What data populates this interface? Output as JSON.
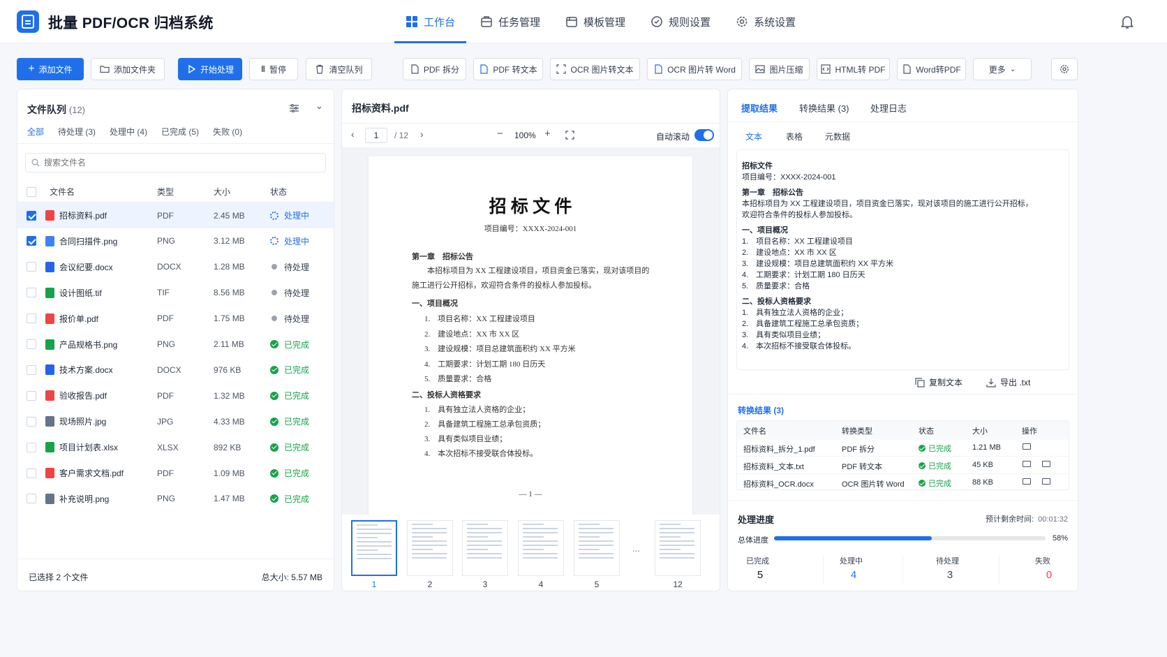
{
  "app": {
    "title": "批量 PDF/OCR 归档系统"
  },
  "nav": [
    {
      "label": "工作台",
      "active": true
    },
    {
      "label": "任务管理"
    },
    {
      "label": "模板管理"
    },
    {
      "label": "规则设置"
    },
    {
      "label": "系统设置"
    }
  ],
  "toolbar": {
    "add_file": "添加文件",
    "add_folder": "添加文件夹",
    "start": "开始处理",
    "pause": "暂停",
    "clear": "清空队列",
    "tools": [
      "PDF 拆分",
      "PDF 转文本",
      "OCR 图片转文本",
      "OCR 图片转 Word",
      "图片压缩",
      "HTML转 PDF",
      "Word转PDF"
    ],
    "more": "更多"
  },
  "queue": {
    "title": "文件队列",
    "count": "(12)",
    "tabs": [
      "全部",
      "待处理 (3)",
      "处理中 (4)",
      "已完成 (5)",
      "失败 (0)"
    ],
    "search_placeholder": "搜索文件名",
    "headers": [
      "文件名",
      "类型",
      "大小",
      "状态"
    ],
    "rows": [
      {
        "name": "招标资料.pdf",
        "type": "PDF",
        "size": "2.45 MB",
        "status": "处理中",
        "state": "processing",
        "checked": true,
        "kind": "pdf"
      },
      {
        "name": "合同扫描件.png",
        "type": "PNG",
        "size": "3.12 MB",
        "status": "处理中",
        "state": "processing",
        "checked": true,
        "kind": "png"
      },
      {
        "name": "会议纪要.docx",
        "type": "DOCX",
        "size": "1.28 MB",
        "status": "待处理",
        "state": "pending",
        "checked": false,
        "kind": "docx"
      },
      {
        "name": "设计图纸.tif",
        "type": "TIF",
        "size": "8.56 MB",
        "status": "待处理",
        "state": "pending",
        "checked": false,
        "kind": "tif"
      },
      {
        "name": "报价单.pdf",
        "type": "PDF",
        "size": "1.75 MB",
        "status": "待处理",
        "state": "pending",
        "checked": false,
        "kind": "pdf"
      },
      {
        "name": "产品规格书.png",
        "type": "PNG",
        "size": "2.11 MB",
        "status": "已完成",
        "state": "done",
        "checked": false,
        "kind": "xls"
      },
      {
        "name": "技术方案.docx",
        "type": "DOCX",
        "size": "976 KB",
        "status": "已完成",
        "state": "done",
        "checked": false,
        "kind": "docx"
      },
      {
        "name": "验收报告.pdf",
        "type": "PDF",
        "size": "1.32 MB",
        "status": "已完成",
        "state": "done",
        "checked": false,
        "kind": "pdf"
      },
      {
        "name": "现场照片.jpg",
        "type": "JPG",
        "size": "4.33 MB",
        "status": "已完成",
        "state": "done",
        "checked": false,
        "kind": "img"
      },
      {
        "name": "项目计划表.xlsx",
        "type": "XLSX",
        "size": "892 KB",
        "status": "已完成",
        "state": "done",
        "checked": false,
        "kind": "xls"
      },
      {
        "name": "客户需求文档.pdf",
        "type": "PDF",
        "size": "1.09 MB",
        "status": "已完成",
        "state": "done",
        "checked": false,
        "kind": "pdf"
      },
      {
        "name": "补充说明.png",
        "type": "PNG",
        "size": "1.47 MB",
        "status": "已完成",
        "state": "done",
        "checked": false,
        "kind": "img"
      }
    ],
    "selected": "已选择 2 个文件",
    "total": "总大小: 5.57 MB"
  },
  "preview": {
    "filename": "招标资料.pdf",
    "page": "1",
    "pages": "/ 12",
    "zoom": "100%",
    "auto_scroll": "自动滚动",
    "doc": {
      "title": "招 标 文 件",
      "number": "项目编号：XXXX-2024-001",
      "ch1": "第一章　招标公告",
      "p1": "本招标项目为 XX 工程建设项目，项目资金已落实，现对该项目的",
      "p2": "施工进行公开招标，欢迎符合条件的投标人参加投标。",
      "s1": "一、项目概况",
      "items1": [
        "1.　项目名称：XX 工程建设项目",
        "2.　建设地点：XX 市 XX 区",
        "3.　建设规模：项目总建筑面积约 XX 平方米",
        "4.　工期要求：计划工期 180 日历天",
        "5.　质量要求：合格"
      ],
      "s2": "二、投标人资格要求",
      "items2": [
        "1.　具有独立法人资格的企业；",
        "2.　具备建筑工程施工总承包资质；",
        "3.　具有类似项目业绩；",
        "4.　本次招标不接受联合体投标。"
      ],
      "footer": "— 1 —"
    },
    "thumbs": [
      "1",
      "2",
      "3",
      "4",
      "5",
      "12"
    ],
    "ellipsis": "..."
  },
  "result": {
    "tabs": [
      "提取结果",
      "转换结果 (3)",
      "处理日志"
    ],
    "subtabs": [
      "文本",
      "表格",
      "元数据"
    ],
    "text_lines": [
      {
        "t": "招标文件",
        "b": true
      },
      {
        "t": "项目编号：XXXX-2024-001"
      },
      {
        "t": "第一章　招标公告",
        "b": true,
        "gap": true
      },
      {
        "t": "本招标项目为 XX 工程建设项目，项目资金已落实，现对该项目的施工进行公开招标，"
      },
      {
        "t": "欢迎符合条件的投标人参加投标。"
      },
      {
        "t": "一、项目概况",
        "b": true,
        "gap": true
      },
      {
        "t": "1.　项目名称：XX 工程建设项目"
      },
      {
        "t": "2.　建设地点：XX 市 XX 区"
      },
      {
        "t": "3.　建设规模：项目总建筑面积约 XX 平方米"
      },
      {
        "t": "4.　工期要求：计划工期 180 日历天"
      },
      {
        "t": "5.　质量要求：合格"
      },
      {
        "t": "二、投标人资格要求",
        "b": true,
        "gap": true
      },
      {
        "t": "1.　具有独立法人资格的企业；"
      },
      {
        "t": "2.　具备建筑工程施工总承包资质；"
      },
      {
        "t": "3.　具有类似项目业绩；"
      },
      {
        "t": "4.　本次招标不接受联合体投标。"
      }
    ],
    "copy": "复制文本",
    "export": "导出 .txt",
    "conv_title": "转换结果 (3)",
    "conv_headers": [
      "文件名",
      "转换类型",
      "状态",
      "大小",
      "操作"
    ],
    "conv_rows": [
      {
        "name": "招标资料_拆分_1.pdf",
        "type": "PDF 拆分",
        "status": "已完成",
        "size": "1.21 MB",
        "icons": 1
      },
      {
        "name": "招标资料_文本.txt",
        "type": "PDF 转文本",
        "status": "已完成",
        "size": "45 KB",
        "icons": 2
      },
      {
        "name": "招标资料_OCR.docx",
        "type": "OCR 图片转 Word",
        "status": "已完成",
        "size": "88 KB",
        "icons": 2
      }
    ],
    "progress": {
      "title": "处理进度",
      "eta_label": "预计剩余时间:",
      "eta": "00:01:32",
      "overall_label": "总体进度",
      "percent": 58,
      "percent_text": "58%"
    },
    "stats": [
      {
        "label": "已完成",
        "value": "5",
        "color": "#111827"
      },
      {
        "label": "处理中",
        "value": "4",
        "color": "#1f6feb"
      },
      {
        "label": "待处理",
        "value": "3",
        "color": "#374151"
      },
      {
        "label": "失败",
        "value": "0",
        "color": "#ef4444"
      }
    ]
  }
}
